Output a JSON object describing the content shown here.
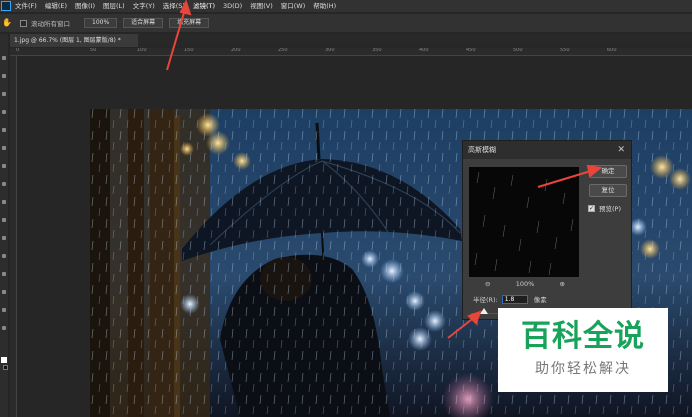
{
  "menu": {
    "items": [
      "文件(F)",
      "编辑(E)",
      "图像(I)",
      "图层(L)",
      "文字(Y)",
      "选择(S)",
      "滤镜(T)",
      "3D(D)",
      "视图(V)",
      "窗口(W)",
      "帮助(H)"
    ],
    "active_index": 6
  },
  "options_bar": {
    "scroll_all_label": "滚动所有窗口",
    "zoom_button": "100%",
    "fit_screen_button": "适合屏幕",
    "fill_screen_button": "填充屏幕"
  },
  "document_tab": {
    "title": "1.jpg @ 66.7% (图层 1, 图层蒙版/8) *"
  },
  "ruler": {
    "top_numbers": [
      "0",
      "50",
      "100",
      "150",
      "200",
      "250",
      "300",
      "350",
      "400",
      "450",
      "500",
      "550",
      "600"
    ]
  },
  "dialog": {
    "title": "高斯模糊",
    "close_symbol": "✕",
    "ok_label": "确定",
    "reset_label": "复位",
    "preview_label": "预览(P)",
    "preview_checked": true,
    "zoom_out_symbol": "⊖",
    "zoom_value": "100%",
    "zoom_in_symbol": "⊕",
    "radius_label": "半径(R):",
    "radius_value": "1.8",
    "radius_unit": "像素"
  },
  "watermark": {
    "title": "百科全说",
    "subtitle": "助你轻松解决"
  },
  "colors": {
    "annotation_red": "#e8453c",
    "watermark_green": "#19a35a",
    "ps_blue": "#31a8ff"
  }
}
